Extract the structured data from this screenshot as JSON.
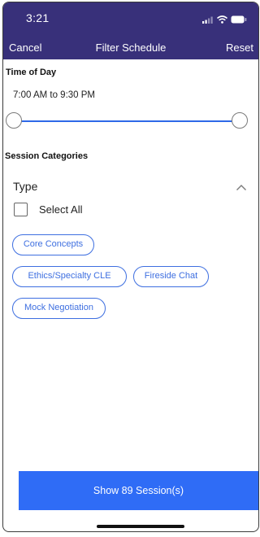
{
  "status_bar": {
    "time": "3:21",
    "icons": [
      "cellular-signal-icon",
      "wifi-icon",
      "battery-icon"
    ],
    "background_color": "#38307a"
  },
  "nav": {
    "cancel_label": "Cancel",
    "title": "Filter Schedule",
    "reset_label": "Reset"
  },
  "time_of_day": {
    "heading": "Time of Day",
    "range_text": "7:00 AM to 9:30 PM",
    "slider_start_fraction": 0.0,
    "slider_end_fraction": 1.0,
    "accent_color": "#2f69e8"
  },
  "session_categories": {
    "heading": "Session Categories",
    "type_label": "Type",
    "type_expanded_icon": "chevron-up-icon",
    "select_all_label": "Select All",
    "select_all_checked": false,
    "chips": [
      "Core Concepts",
      "Ethics/Specialty CLE",
      "Fireside Chat",
      "Mock Negotiation"
    ],
    "chip_color": "#3e6fe0"
  },
  "show_button": {
    "label": "Show 89 Session(s)",
    "color": "#2f6cf6"
  }
}
